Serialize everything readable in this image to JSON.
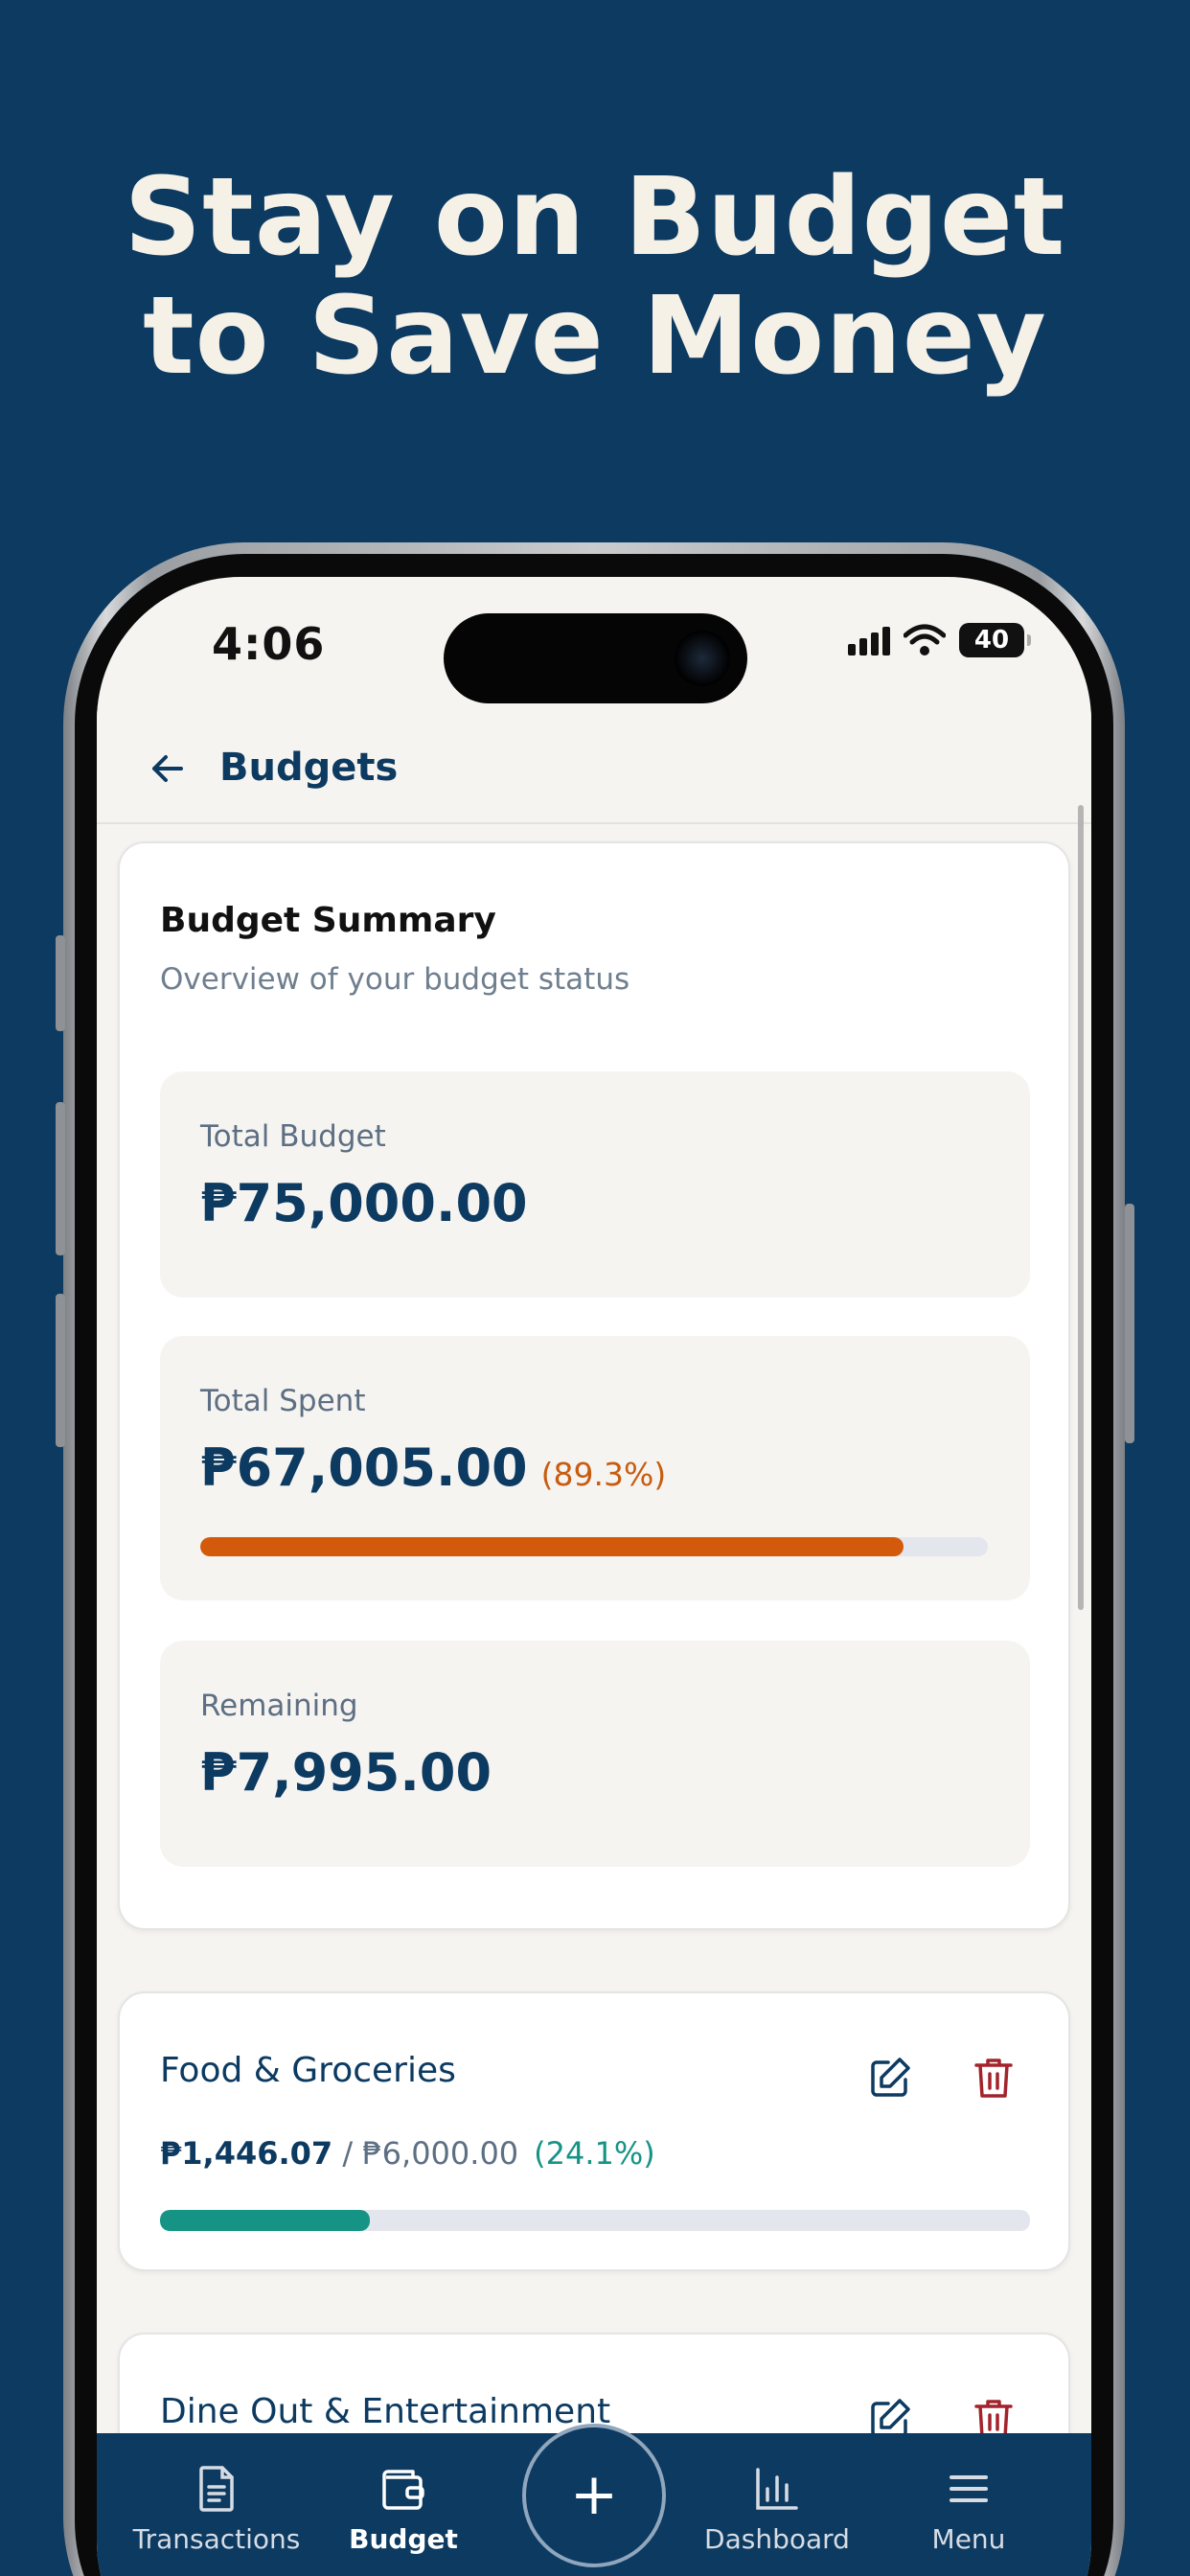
{
  "headline": {
    "line1": "Stay on Budget",
    "line2": "to Save Money"
  },
  "status_bar": {
    "time": "4:06",
    "battery": "40"
  },
  "header": {
    "title": "Budgets"
  },
  "summary": {
    "title": "Budget Summary",
    "subtitle": "Overview of your budget status",
    "total_budget": {
      "label": "Total Budget",
      "value": "₱75,000.00"
    },
    "total_spent": {
      "label": "Total Spent",
      "value": "₱67,005.00",
      "percent": "(89.3%)",
      "progress": 0.893
    },
    "remaining": {
      "label": "Remaining",
      "value": "₱7,995.00"
    }
  },
  "categories": [
    {
      "name": "Food & Groceries",
      "spent": "₱1,446.07",
      "separator": " / ",
      "budget": "₱6,000.00",
      "percent": "(24.1%)",
      "progress": 0.241
    },
    {
      "name": "Dine Out & Entertainment"
    }
  ],
  "tabbar": {
    "tabs": [
      {
        "label": "Transactions",
        "icon": "document-icon"
      },
      {
        "label": "Budget",
        "icon": "wallet-icon"
      },
      {
        "label": "Dashboard",
        "icon": "bar-chart-icon"
      },
      {
        "label": "Menu",
        "icon": "menu-icon"
      }
    ],
    "fab": "+"
  },
  "colors": {
    "brand": "#0c3a61",
    "spent_bar": "#d35a0a",
    "category_bar": "#159486",
    "delete": "#a3232b"
  }
}
